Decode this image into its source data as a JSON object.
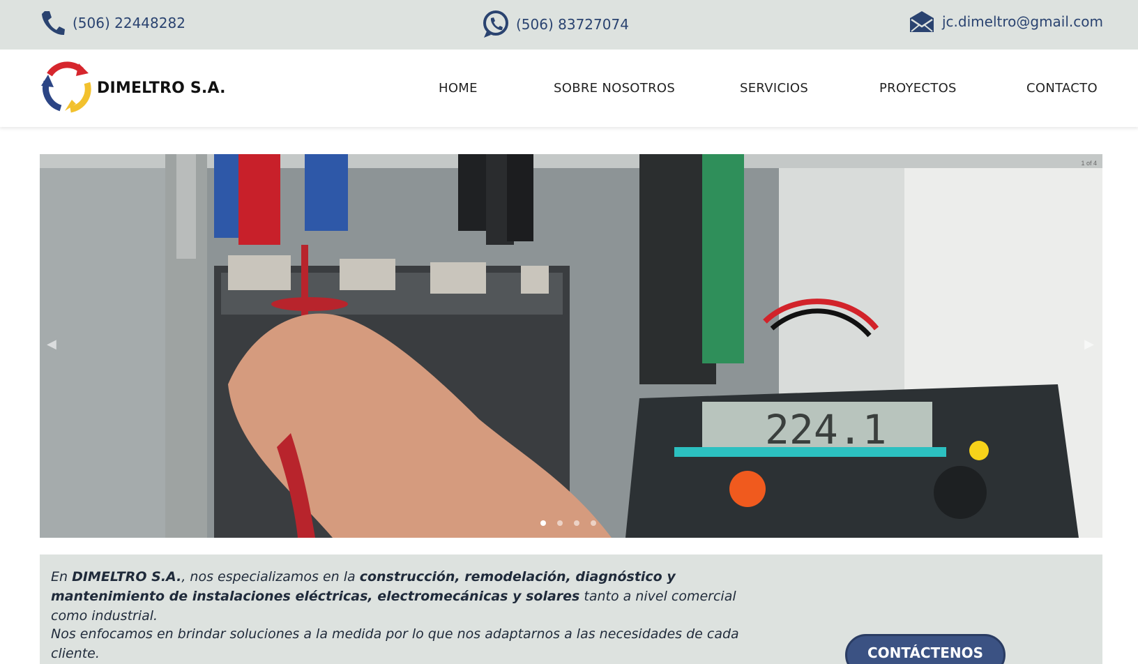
{
  "topbar": {
    "phone": "(506) 22448282",
    "whatsapp": "(506) 83727074",
    "email": "jc.dimeltro@gmail.com",
    "icons": {
      "phone": "phone-icon",
      "whatsapp": "whatsapp-icon",
      "email": "envelope-icon"
    },
    "color": "#2a4370"
  },
  "header": {
    "brand": "DIMELTRO S.A.",
    "nav": [
      "HOME",
      "SOBRE NOSOTROS",
      "SERVICIOS",
      "PROYECTOS",
      "CONTACTO"
    ]
  },
  "slider": {
    "counter": "1 of 4",
    "prev_arrow": "◀",
    "next_arrow": "▶",
    "active_slide": 1,
    "total_slides": 4,
    "meter_reading": "224.1"
  },
  "intro": {
    "p1_a": "En ",
    "p1_b": "DIMELTRO S.A.",
    "p1_c": ", nos especializamos en la ",
    "p1_d": "construcción, remodelación, diagnóstico y mantenimiento de instalaciones eléctricas, electromecánicas y solares",
    "p1_e": " tanto a nivel comercial como industrial.",
    "p2": "Nos enfocamos en brindar soluciones a la medida por lo que nos adaptarnos a las necesidades de cada cliente.",
    "cta": "CONTÁCTENOS"
  },
  "colors": {
    "topbar_bg": "#dde2df",
    "brand_blue": "#2a4370",
    "cta_bg": "#3b5283"
  }
}
